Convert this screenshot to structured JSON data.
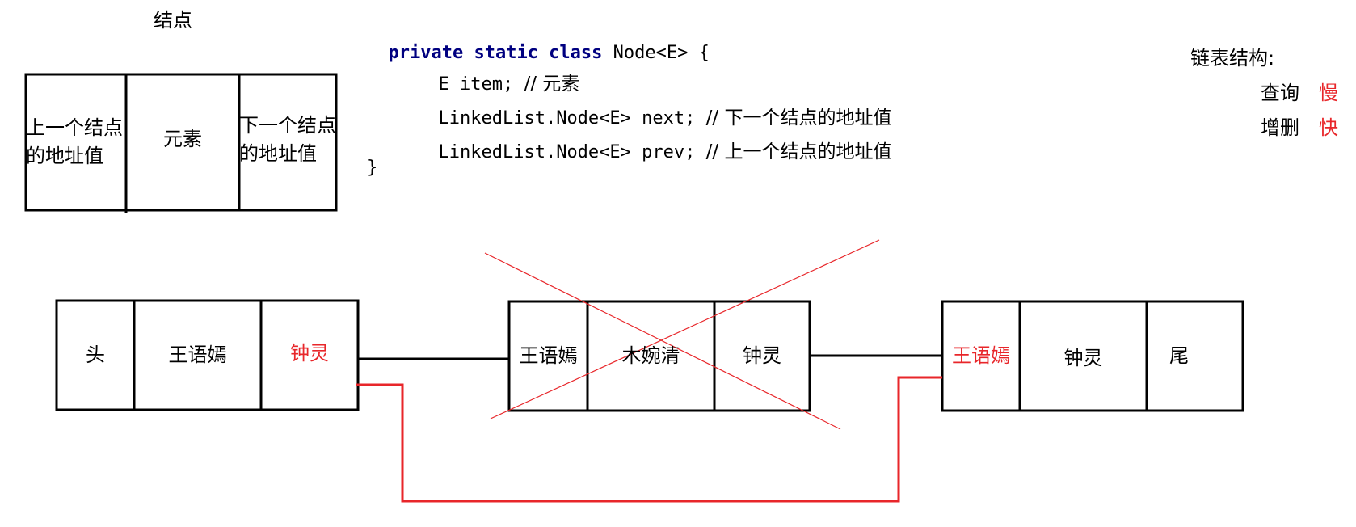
{
  "node_legend": {
    "title": "结点",
    "prev_cell": [
      "上一个结点",
      "的地址值"
    ],
    "element_cell": "元素",
    "next_cell": [
      "下一个结点",
      "的地址值"
    ]
  },
  "code": {
    "line1_keywords": "private static class",
    "line1_rest": " Node<E> {",
    "line2_code": "E item; ",
    "line2_comment": "// 元素",
    "line3_code": "LinkedList.Node<E> next; ",
    "line3_comment": "// 下一个结点的地址值",
    "line4_code": "LinkedList.Node<E> prev; ",
    "line4_comment": "// 上一个结点的地址值",
    "line5": "}"
  },
  "list_structure": {
    "title": "链表结构:",
    "query_label": "查询",
    "query_value": "慢",
    "modify_label": "增删",
    "modify_value": "快"
  },
  "nodes": [
    {
      "cells": [
        "头",
        "王语嫣",
        "钟灵"
      ]
    },
    {
      "cells": [
        "王语嫣",
        "木婉清",
        "钟灵"
      ]
    },
    {
      "cells": [
        "王语嫣",
        "钟灵",
        "尾"
      ]
    }
  ],
  "colors": {
    "accent_red": "#e8262a",
    "line_black": "#000000",
    "code_keyword": "#000080"
  }
}
